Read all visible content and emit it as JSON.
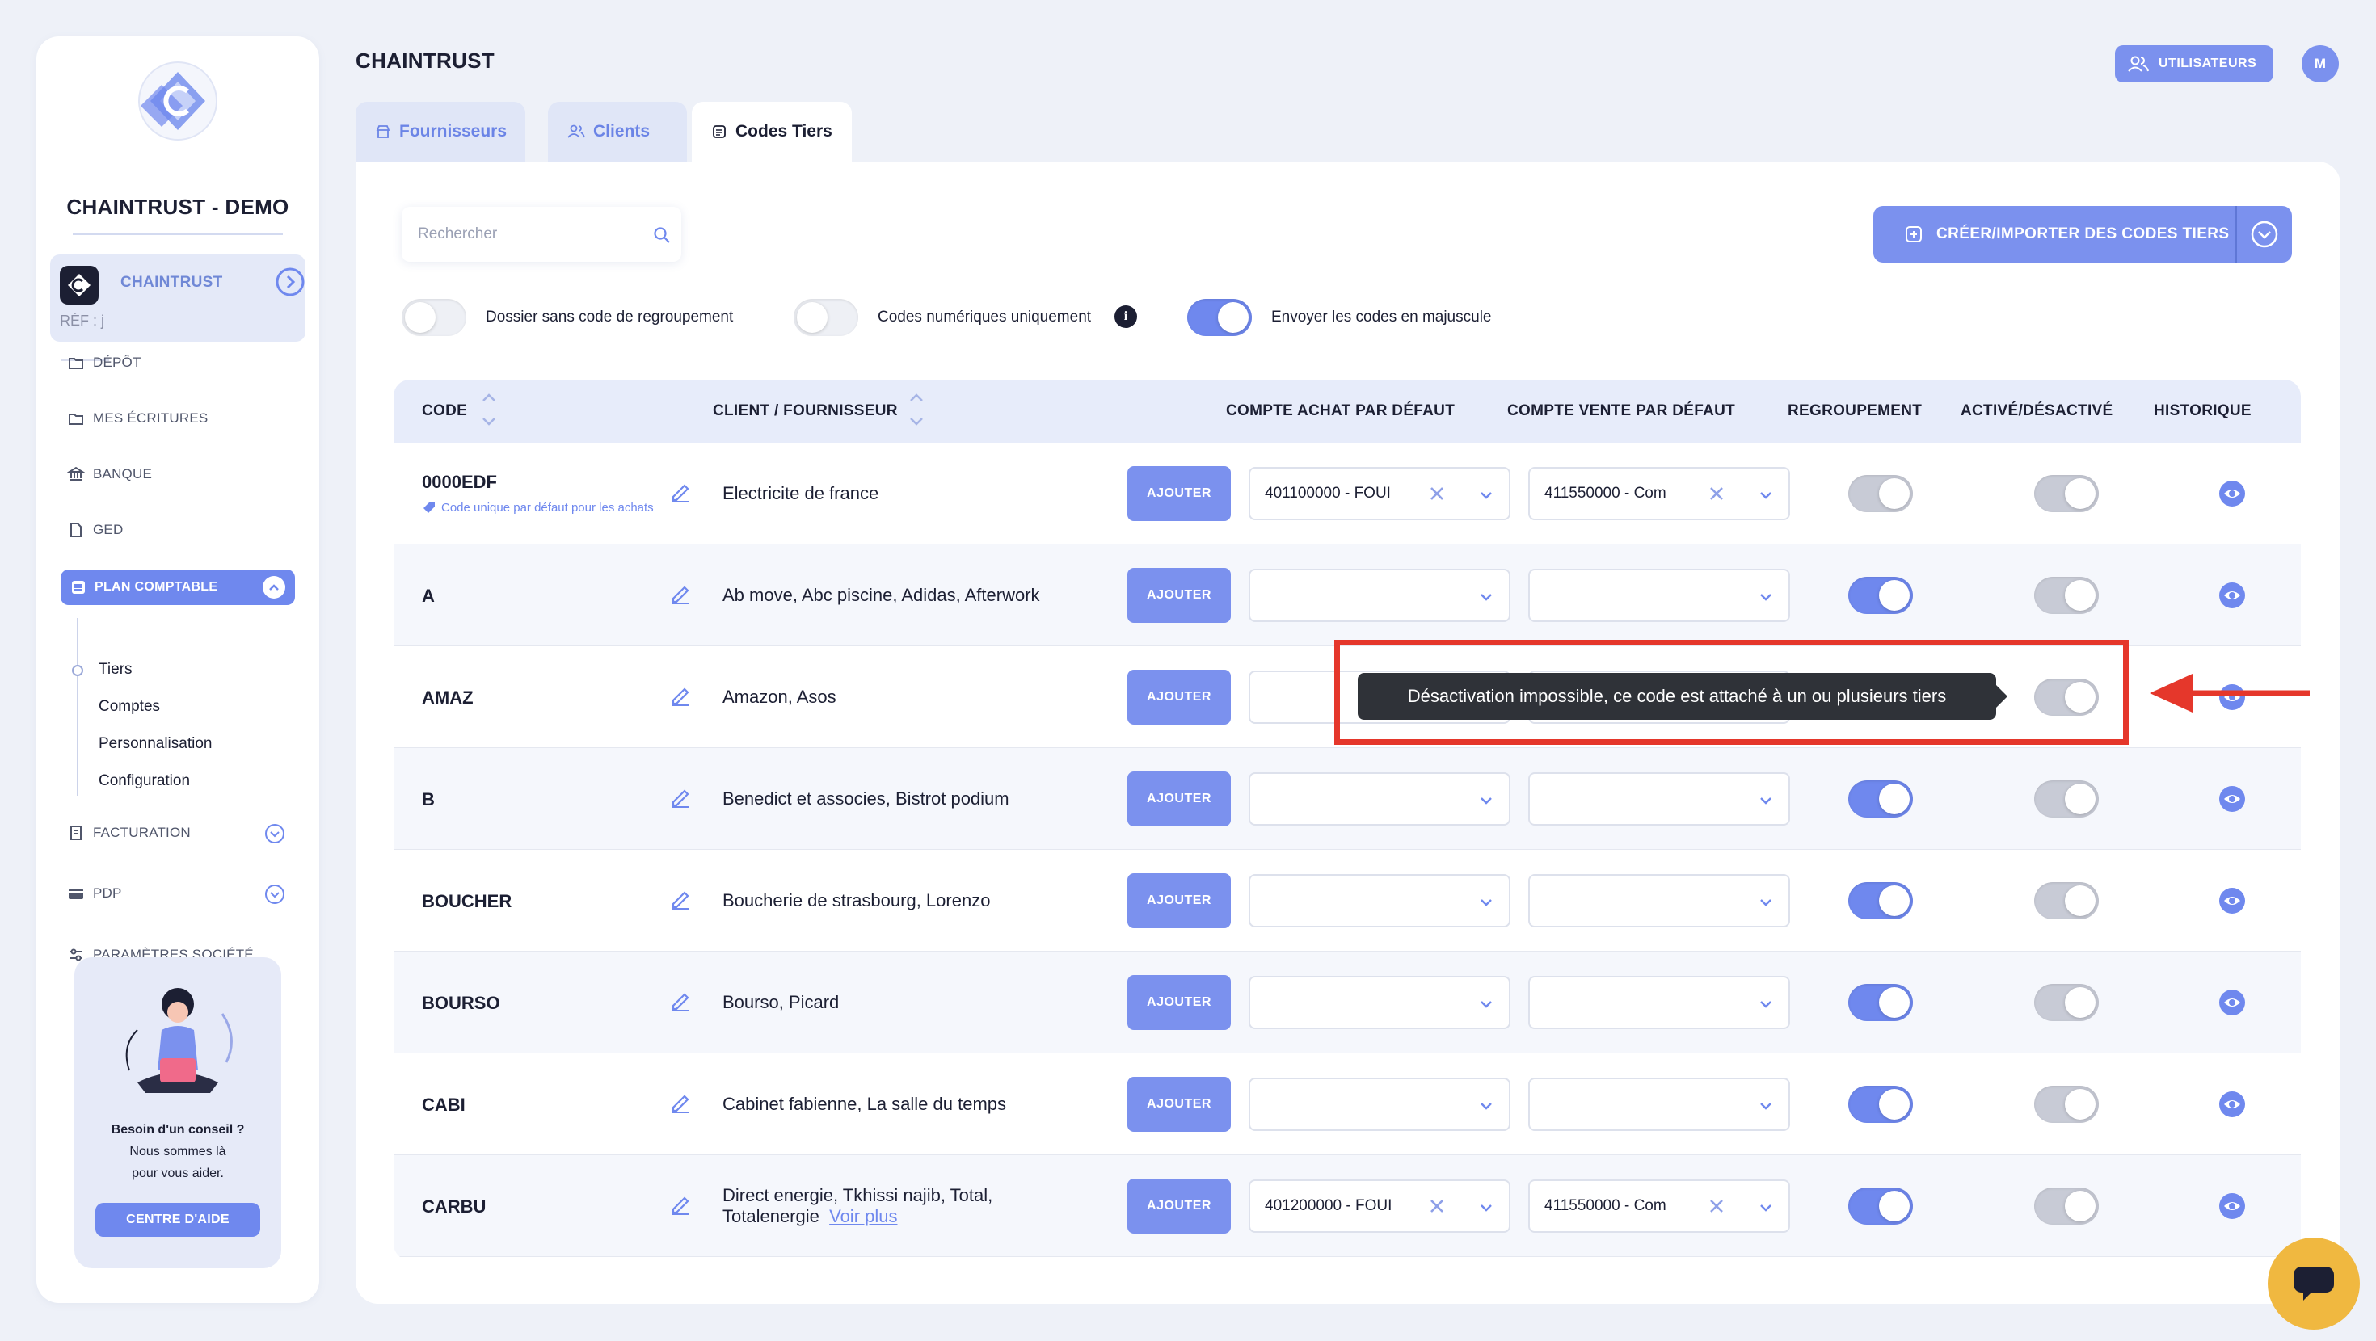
{
  "sidebar": {
    "company": "CHAINTRUST - DEMO",
    "account": {
      "name": "CHAINTRUST",
      "ref": "RÉF : j"
    },
    "nav": [
      {
        "label": "DÉPÔT"
      },
      {
        "label": "MES ÉCRITURES"
      },
      {
        "label": "BANQUE"
      },
      {
        "label": "GED"
      },
      {
        "label": "PLAN COMPTABLE"
      },
      {
        "label": "FACTURATION"
      },
      {
        "label": "PDP"
      },
      {
        "label": "PARAMÈTRES SOCIÉTÉ"
      }
    ],
    "sub": [
      "Tiers",
      "Comptes",
      "Personnalisation",
      "Configuration"
    ],
    "help": {
      "line1": "Besoin d'un conseil ?",
      "line2": "Nous sommes là",
      "line3": "pour vous aider.",
      "button": "CENTRE D'AIDE"
    }
  },
  "header": {
    "title": "CHAINTRUST",
    "users_button": "UTILISATEURS",
    "avatar": "M"
  },
  "tabs": [
    {
      "label": "Fournisseurs"
    },
    {
      "label": "Clients"
    },
    {
      "label": "Codes Tiers"
    }
  ],
  "toolbar": {
    "search_placeholder": "Rechercher",
    "create_button": "CRÉER/IMPORTER DES CODES TIERS"
  },
  "options": [
    {
      "label": "Dossier sans code de regroupement",
      "on": false
    },
    {
      "label": "Codes numériques uniquement",
      "on": false,
      "info": "i"
    },
    {
      "label": "Envoyer les codes en majuscule",
      "on": true
    }
  ],
  "table": {
    "headers": {
      "code": "CODE",
      "client": "CLIENT / FOURNISSEUR",
      "achat": "COMPTE ACHAT PAR DÉFAUT",
      "vente": "COMPTE VENTE PAR DÉFAUT",
      "regroupement": "REGROUPEMENT",
      "active": "ACTIVÉ/DÉSACTIVÉ",
      "historique": "HISTORIQUE"
    },
    "add_label": "AJOUTER",
    "rows": [
      {
        "code": "0000EDF",
        "note": "Code unique par défaut pour les achats",
        "client": "Electricite de france",
        "achat": "401100000 - FOUI",
        "vente": "411550000 - Com",
        "regroupement": false,
        "active": true
      },
      {
        "code": "A",
        "client": "Ab move, Abc piscine, Adidas, Afterwork",
        "achat": "",
        "vente": "",
        "regroupement": true,
        "active": true
      },
      {
        "code": "AMAZ",
        "client": "Amazon, Asos",
        "achat": "",
        "vente": "",
        "regroupement": true,
        "active": true
      },
      {
        "code": "B",
        "client": "Benedict et associes, Bistrot podium",
        "achat": "",
        "vente": "",
        "regroupement": true,
        "active": true
      },
      {
        "code": "BOUCHER",
        "client": "Boucherie de strasbourg, Lorenzo",
        "achat": "",
        "vente": "",
        "regroupement": true,
        "active": true
      },
      {
        "code": "BOURSO",
        "client": "Bourso, Picard",
        "achat": "",
        "vente": "",
        "regroupement": true,
        "active": true
      },
      {
        "code": "CABI",
        "client": "Cabinet fabienne, La salle du temps",
        "achat": "",
        "vente": "",
        "regroupement": true,
        "active": true
      },
      {
        "code": "CARBU",
        "client": "Direct energie, Tkhissi najib, Total,",
        "client_line2": "Totalenergie",
        "more": "Voir plus",
        "achat": "401200000 - FOUI",
        "vente": "411550000 - Com",
        "regroupement": true,
        "active": true
      }
    ]
  },
  "tooltip": "Désactivation impossible, ce code est attaché à un ou plusieurs tiers",
  "colors": {
    "accent": "#6f88ee",
    "annotation": "#e5372b",
    "chat": "#f0b840"
  }
}
